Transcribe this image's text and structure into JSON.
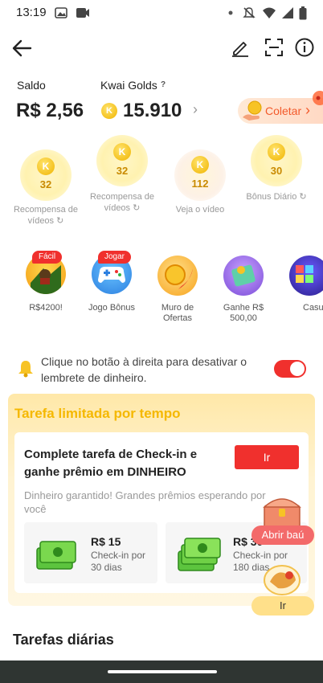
{
  "status_bar": {
    "time": "13:19"
  },
  "header": {
    "back_icon": "arrow-left-icon",
    "edit_icon": "pencil-icon",
    "scan_icon": "scan-icon",
    "info_icon": "info-icon"
  },
  "balance": {
    "saldo_label": "Saldo",
    "saldo_value": "R$ 2,56",
    "golds_label": "Kwai Golds",
    "golds_help": "?",
    "golds_value": "15.910",
    "golds_chevron": "›",
    "collect_label": "Coletar",
    "collect_chevron": "›"
  },
  "coin_letter": "K",
  "rewards": [
    {
      "amount": "32",
      "label1": "Recompensa de",
      "label2": "vídeos"
    },
    {
      "amount": "32",
      "label1": "Recompensa de",
      "label2": "vídeos"
    },
    {
      "amount": "112",
      "label1": "Veja o vídeo",
      "label2": ""
    },
    {
      "amount": "30",
      "label1": "Bônus Diário",
      "label2": ""
    }
  ],
  "games": [
    {
      "tag": "Fácil",
      "label1": "R$4200!",
      "label2": ""
    },
    {
      "tag": "Jogar",
      "label1": "Jogo Bônus",
      "label2": ""
    },
    {
      "tag": "",
      "label1": "Muro de",
      "label2": "Ofertas"
    },
    {
      "tag": "",
      "label1": "Ganhe R$",
      "label2": "500,00"
    },
    {
      "tag": "",
      "label1": "Casu",
      "label2": ""
    }
  ],
  "reminder": {
    "text": "Clique no botão à direita para desativar o lembrete de dinheiro.",
    "toggle_on": true
  },
  "limited_task": {
    "section_title": "Tarefa limitada por tempo",
    "title": "Complete tarefa de Check-in e ganhe prêmio em DINHEIRO",
    "button": "Ir",
    "subtitle": "Dinheiro garantido! Grandes prêmios esperando por você",
    "prizes": [
      {
        "amount": "R$ 15",
        "duration1": "Check-in por",
        "duration2": "30 dias"
      },
      {
        "amount": "R$ 30",
        "duration1": "Check-in por",
        "duration2": "180 dias"
      }
    ]
  },
  "floating": {
    "chest_label": "Abrir baú",
    "go_label": "Ir"
  },
  "daily_tasks": {
    "title": "Tarefas diárias"
  },
  "colors": {
    "accent_red": "#f0302d",
    "gold": "#f5b800",
    "collect_text": "#f35a2b"
  }
}
